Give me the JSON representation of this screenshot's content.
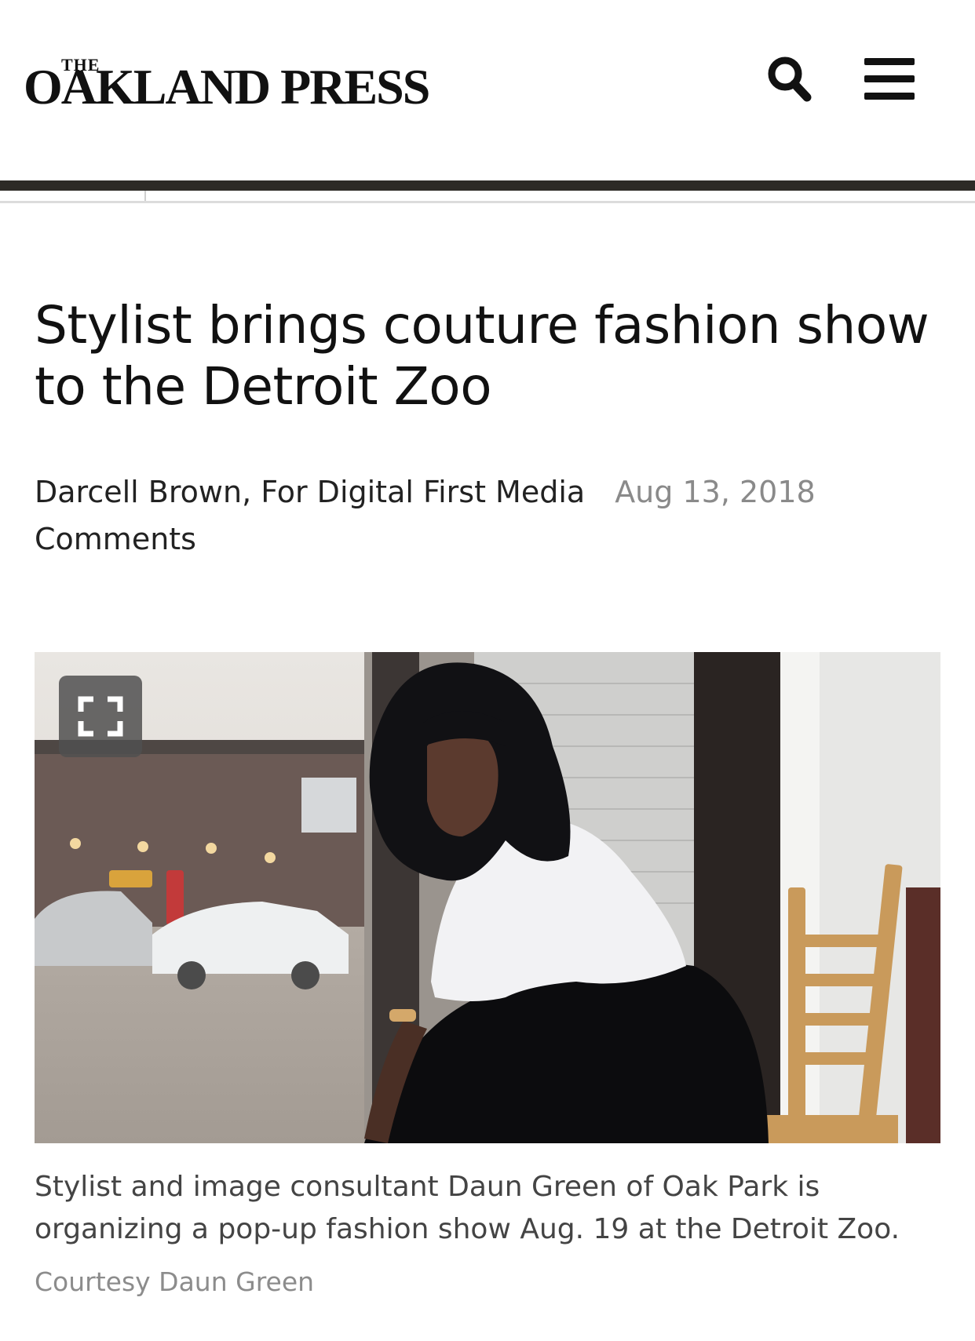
{
  "header": {
    "logo_the": "THE",
    "logo_main": "OAKLAND PRESS",
    "search_icon": "search-icon",
    "menu_icon": "hamburger-menu-icon"
  },
  "article": {
    "headline": "Stylist brings couture fashion show to the Detroit Zoo",
    "author": "Darcell Brown, For Digital First Media",
    "date": "Aug 13, 2018",
    "comments_label": "Comments"
  },
  "photo": {
    "expand_icon": "fullscreen-expand-icon",
    "caption": "Stylist and image consultant Daun Green of Oak Park is organizing a pop-up fashion show Aug. 19 at the Detroit Zoo.",
    "credit": "Courtesy Daun Green"
  },
  "colors": {
    "rule": "#2d2a26",
    "text": "#111111",
    "date": "#8a8a8a",
    "caption": "#444444",
    "credit": "#8c8c8c"
  }
}
